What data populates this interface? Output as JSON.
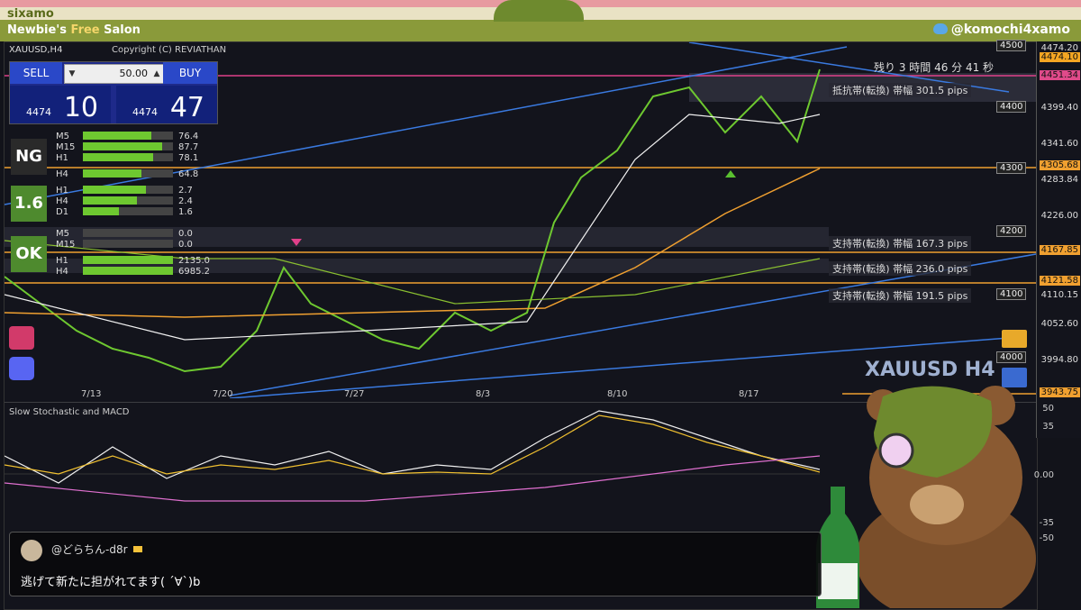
{
  "header": {
    "brand": "sixamo",
    "salon_prefix": "Newbie's ",
    "salon_free": "Free",
    "salon_suffix": " Salon",
    "twitter_handle": "@komochi4xamo"
  },
  "chart": {
    "symbol": "XAUUSD,H4",
    "copyright": "Copyright (C) REVIATHAN",
    "watermark": "XAUUSD H4",
    "remaining": "残り 3 時間 46 分 41 秒",
    "dates": [
      "7/13",
      "7/20",
      "7/27",
      "8/3",
      "8/10",
      "8/17"
    ],
    "price_ticks": [
      "4474.20",
      "4399.40",
      "4341.60",
      "4283.84",
      "4226.00",
      "4110.15",
      "4052.60",
      "3994.80"
    ],
    "round_labels": [
      "4500",
      "4400",
      "4300",
      "4200",
      "4100",
      "4000"
    ],
    "badges": [
      {
        "text": "4474.10",
        "color": "#f5a623"
      },
      {
        "text": "4451.34",
        "color": "#e04a8a"
      },
      {
        "text": "4305.68",
        "color": "#f0a030"
      },
      {
        "text": "4167.85",
        "color": "#f0a030"
      },
      {
        "text": "4121.58",
        "color": "#f0a030"
      },
      {
        "text": "3943.75",
        "color": "#f0a030"
      }
    ],
    "zones": [
      {
        "label": "抵抗帯(転換) 帯幅 301.5 pips"
      },
      {
        "label": "支持帯(転換) 帯幅 167.3 pips"
      },
      {
        "label": "支持帯(転換) 帯幅 236.0 pips"
      },
      {
        "label": "支持帯(転換) 帯幅 191.5 pips"
      }
    ],
    "sub_title": "Slow Stochastic and MACD",
    "sub_ticks": [
      "50",
      "35",
      "0.00",
      "-35",
      "-50"
    ]
  },
  "trade_panel": {
    "sell_label": "SELL",
    "buy_label": "BUY",
    "lot": "50.00",
    "down_glyph": "▼",
    "up_glyph": "▲",
    "bid_prefix": "4474",
    "bid_big": "10",
    "ask_prefix": "4474",
    "ask_big": "47"
  },
  "signals": {
    "badges": [
      {
        "text": "NG",
        "color": "#2a2a2a"
      },
      {
        "text": "1.6",
        "color": "#4e8a2e"
      },
      {
        "text": "OK",
        "color": "#4e8a2e"
      }
    ],
    "rows": [
      {
        "tf": "M5",
        "val": "76.4",
        "strength": 0.76
      },
      {
        "tf": "M15",
        "val": "87.7",
        "strength": 0.88
      },
      {
        "tf": "H1",
        "val": "78.1",
        "strength": 0.78
      },
      {
        "tf": "H4",
        "val": "64.8",
        "strength": 0.65
      },
      {
        "tf": "H1",
        "val": "2.7",
        "strength": 0.7
      },
      {
        "tf": "H4",
        "val": "2.4",
        "strength": 0.6
      },
      {
        "tf": "D1",
        "val": "1.6",
        "strength": 0.4
      },
      {
        "tf": "M5",
        "val": "0.0",
        "strength": 0.0
      },
      {
        "tf": "M15",
        "val": "0.0",
        "strength": 0.0
      },
      {
        "tf": "H1",
        "val": "2135.0",
        "strength": 1.0
      },
      {
        "tf": "H4",
        "val": "6985.2",
        "strength": 1.0
      }
    ]
  },
  "comment": {
    "user": "@どらちん-d8r",
    "text": "逃げて新たに担がれてます( ´∀`)b"
  }
}
